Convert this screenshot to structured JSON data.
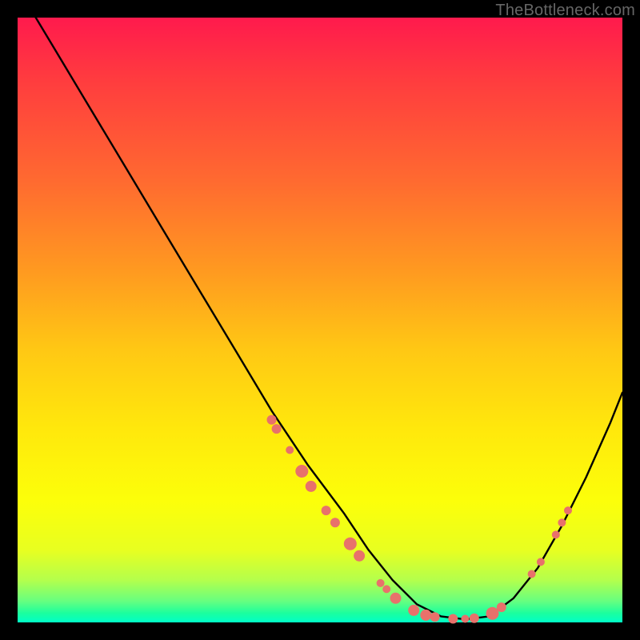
{
  "watermark": "TheBottleneck.com",
  "colors": {
    "marker_fill": "#e8716b",
    "curve_stroke": "#000000",
    "frame_border": "#000000"
  },
  "chart_data": {
    "type": "line",
    "title": "",
    "xlabel": "",
    "ylabel": "",
    "xlim": [
      0,
      100
    ],
    "ylim": [
      0,
      100
    ],
    "grid": false,
    "legend": false,
    "series": [
      {
        "name": "bottleneck-curve",
        "x": [
          0,
          6,
          12,
          18,
          24,
          30,
          36,
          42,
          48,
          54,
          58,
          62,
          66,
          70,
          74,
          78,
          82,
          86,
          90,
          94,
          98,
          100
        ],
        "y": [
          105,
          95,
          85,
          75,
          65,
          55,
          45,
          35,
          26,
          18,
          12,
          7,
          3,
          1,
          0.5,
          1,
          4,
          9,
          16,
          24,
          33,
          38
        ]
      }
    ],
    "markers": [
      {
        "x": 42.0,
        "y": 33.5,
        "r": 6
      },
      {
        "x": 42.8,
        "y": 32.0,
        "r": 6
      },
      {
        "x": 45.0,
        "y": 28.5,
        "r": 5
      },
      {
        "x": 47.0,
        "y": 25.0,
        "r": 8
      },
      {
        "x": 48.5,
        "y": 22.5,
        "r": 7
      },
      {
        "x": 51.0,
        "y": 18.5,
        "r": 6
      },
      {
        "x": 52.5,
        "y": 16.5,
        "r": 6
      },
      {
        "x": 55.0,
        "y": 13.0,
        "r": 8
      },
      {
        "x": 56.5,
        "y": 11.0,
        "r": 7
      },
      {
        "x": 60.0,
        "y": 6.5,
        "r": 5
      },
      {
        "x": 61.0,
        "y": 5.5,
        "r": 5
      },
      {
        "x": 62.5,
        "y": 4.0,
        "r": 7
      },
      {
        "x": 65.5,
        "y": 2.0,
        "r": 7
      },
      {
        "x": 67.5,
        "y": 1.2,
        "r": 7
      },
      {
        "x": 69.0,
        "y": 0.9,
        "r": 6
      },
      {
        "x": 72.0,
        "y": 0.6,
        "r": 6
      },
      {
        "x": 74.0,
        "y": 0.6,
        "r": 5
      },
      {
        "x": 75.5,
        "y": 0.7,
        "r": 6
      },
      {
        "x": 78.5,
        "y": 1.5,
        "r": 8
      },
      {
        "x": 80.0,
        "y": 2.5,
        "r": 6
      },
      {
        "x": 85.0,
        "y": 8.0,
        "r": 5
      },
      {
        "x": 86.5,
        "y": 10.0,
        "r": 5
      },
      {
        "x": 89.0,
        "y": 14.5,
        "r": 5
      },
      {
        "x": 90.0,
        "y": 16.5,
        "r": 5
      },
      {
        "x": 91.0,
        "y": 18.5,
        "r": 5
      }
    ]
  }
}
